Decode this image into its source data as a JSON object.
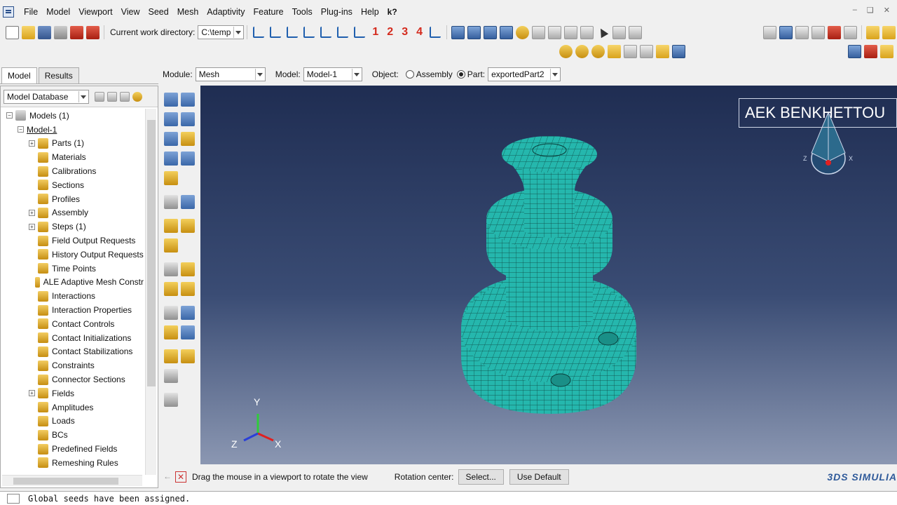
{
  "menu": {
    "items": [
      {
        "label": "File",
        "key": "F"
      },
      {
        "label": "Model",
        "key": "M"
      },
      {
        "label": "Viewport",
        "key": "V"
      },
      {
        "label": "View",
        "key": "V"
      },
      {
        "label": "Seed",
        "key": "S"
      },
      {
        "label": "Mesh",
        "key": "e"
      },
      {
        "label": "Adaptivity",
        "key": "A"
      },
      {
        "label": "Feature",
        "key": "F"
      },
      {
        "label": "Tools",
        "key": "T"
      },
      {
        "label": "Plug-ins",
        "key": "P"
      },
      {
        "label": "Help",
        "key": "H"
      }
    ],
    "whats_this": "k?"
  },
  "toolbar": {
    "cwd_label": "Current work directory:",
    "cwd_value": "C:\\temp",
    "view_numbers": [
      "1",
      "2",
      "3",
      "4"
    ]
  },
  "tabs": {
    "model": "Model",
    "results": "Results"
  },
  "context": {
    "module_label": "Module:",
    "module_value": "Mesh",
    "model_label": "Model:",
    "model_value": "Model-1",
    "object_label": "Object:",
    "assembly_label": "Assembly",
    "part_label": "Part:",
    "part_value": "exportedPart2"
  },
  "tree": {
    "db_label": "Model Database",
    "nodes": [
      {
        "label": "Models (1)",
        "indent": 0,
        "expander": "minus"
      },
      {
        "label": "Model-1",
        "indent": 1,
        "expander": "minus"
      },
      {
        "label": "Parts (1)",
        "indent": 2,
        "expander": "plus"
      },
      {
        "label": "Materials",
        "indent": 2
      },
      {
        "label": "Calibrations",
        "indent": 2
      },
      {
        "label": "Sections",
        "indent": 2
      },
      {
        "label": "Profiles",
        "indent": 2
      },
      {
        "label": "Assembly",
        "indent": 2,
        "expander": "plus"
      },
      {
        "label": "Steps (1)",
        "indent": 2,
        "expander": "plus"
      },
      {
        "label": "Field Output Requests",
        "indent": 2
      },
      {
        "label": "History Output Requests",
        "indent": 2
      },
      {
        "label": "Time Points",
        "indent": 2
      },
      {
        "label": "ALE Adaptive Mesh Constr",
        "indent": 2
      },
      {
        "label": "Interactions",
        "indent": 2
      },
      {
        "label": "Interaction Properties",
        "indent": 2
      },
      {
        "label": "Contact Controls",
        "indent": 2
      },
      {
        "label": "Contact Initializations",
        "indent": 2
      },
      {
        "label": "Contact Stabilizations",
        "indent": 2
      },
      {
        "label": "Constraints",
        "indent": 2
      },
      {
        "label": "Connector Sections",
        "indent": 2
      },
      {
        "label": "Fields",
        "indent": 2,
        "expander": "plus"
      },
      {
        "label": "Amplitudes",
        "indent": 2
      },
      {
        "label": "Loads",
        "indent": 2
      },
      {
        "label": "BCs",
        "indent": 2
      },
      {
        "label": "Predefined Fields",
        "indent": 2
      },
      {
        "label": "Remeshing Rules",
        "indent": 2
      }
    ]
  },
  "viewport": {
    "title_text": "AEK BENKHETTOU",
    "triad": {
      "x": "X",
      "y": "Y",
      "z": "Z"
    },
    "mesh_color": "#25b7ad",
    "mesh_line_color": "#0b3f3b"
  },
  "prompt": {
    "text": "Drag the mouse in a viewport to rotate the view",
    "rotation_label": "Rotation center:",
    "select_button": "Select...",
    "default_button": "Use Default",
    "brand": "3DS SIMULIA"
  },
  "messages": {
    "text": "Global seeds have been assigned."
  }
}
